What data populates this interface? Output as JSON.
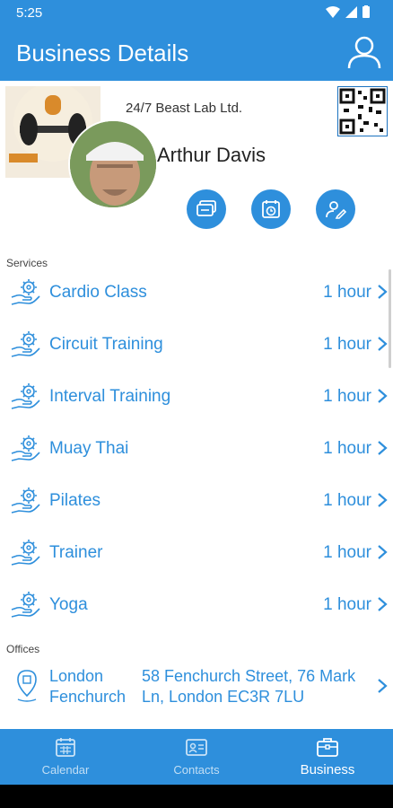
{
  "status": {
    "time": "5:25"
  },
  "app_bar": {
    "title": "Business Details"
  },
  "business": {
    "name": "24/7 Beast Lab Ltd.",
    "person": "Arthur Davis"
  },
  "sections": {
    "services": "Services",
    "offices": "Offices"
  },
  "services": [
    {
      "name": "Cardio Class",
      "duration": "1 hour"
    },
    {
      "name": "Circuit Training",
      "duration": "1 hour"
    },
    {
      "name": "Interval Training",
      "duration": "1 hour"
    },
    {
      "name": "Muay Thai",
      "duration": "1 hour"
    },
    {
      "name": "Pilates",
      "duration": "1 hour"
    },
    {
      "name": "Trainer",
      "duration": "1 hour"
    },
    {
      "name": "Yoga",
      "duration": "1 hour"
    }
  ],
  "offices": [
    {
      "name": "London Fenchurch",
      "address": "58 Fenchurch Street, 76 Mark Ln, London EC3R 7LU"
    }
  ],
  "nav": [
    {
      "label": "Calendar",
      "icon": "calendar-icon"
    },
    {
      "label": "Contacts",
      "icon": "contact-card-icon"
    },
    {
      "label": "Business",
      "icon": "briefcase-icon",
      "active": true
    }
  ],
  "colors": {
    "primary": "#2e8fdc",
    "text": "#222222"
  }
}
